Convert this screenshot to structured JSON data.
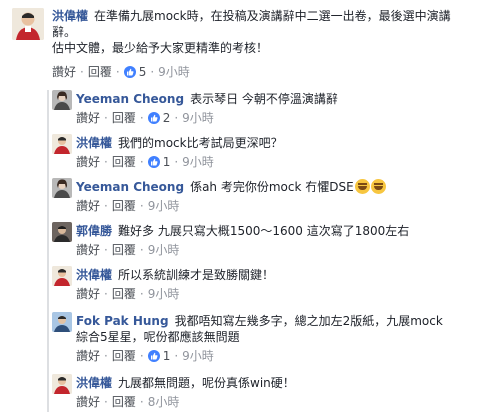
{
  "comments": [
    {
      "name": "洪偉權",
      "text_lines": [
        "在準備九展mock時，在投稿及演講辭中二選一出卷，最後選中演講",
        "辭。",
        "估中文體，最少給予大家更精準的考核！"
      ],
      "like_label": "讚好",
      "reply_label": "回覆",
      "like_count": "5",
      "time": "9小時",
      "avatar": "person-photo-red"
    },
    {
      "name": "Yeeman Cheong",
      "text_lines": [
        "表示琴日 今朝不停溫演講辭"
      ],
      "like_label": "讚好",
      "reply_label": "回覆",
      "like_count": "2",
      "time": "9小時",
      "avatar": "person-photo-gray"
    },
    {
      "name": "洪偉權",
      "text_lines": [
        "我們的mock比考試局更深吧？"
      ],
      "like_label": "讚好",
      "reply_label": "回覆",
      "like_count": "1",
      "time": "9小時",
      "avatar": "person-photo-red"
    },
    {
      "name": "Yeeman Cheong",
      "text_lines": [
        "係ah 考完你份mock 冇懼DSE"
      ],
      "like_label": "讚好",
      "reply_label": "回覆",
      "like_count": "",
      "time": "9小時",
      "avatar": "person-photo-gray",
      "emojis": [
        "laughing-emoji",
        "laughing-emoji"
      ]
    },
    {
      "name": "郭偉勝",
      "text_lines": [
        "難好多 九展只寫大概1500～1600 這次寫了1800左右"
      ],
      "like_label": "讚好",
      "reply_label": "回覆",
      "like_count": "",
      "time": "9小時",
      "avatar": "person-photo-dark"
    },
    {
      "name": "洪偉權",
      "text_lines": [
        "所以系統訓練才是致勝關鍵！"
      ],
      "like_label": "讚好",
      "reply_label": "回覆",
      "like_count": "",
      "time": "9小時",
      "avatar": "person-photo-red"
    },
    {
      "name": "Fok Pak Hung",
      "text_lines": [
        "我都唔知寫左幾多字，總之加左2版紙，九展mock",
        "綜合5星星，呢份都應該無問題"
      ],
      "like_label": "讚好",
      "reply_label": "回覆",
      "like_count": "1",
      "time": "9小時",
      "avatar": "person-photo-blue"
    },
    {
      "name": "洪偉權",
      "text_lines": [
        "九展都無問題，呢份真係win硬！"
      ],
      "like_label": "讚好",
      "reply_label": "回覆",
      "like_count": "",
      "time": "8小時",
      "avatar": "person-photo-red"
    }
  ],
  "colors": {
    "name": "#365899",
    "text": "#1d2129",
    "meta": "#90949c",
    "like_badge": "#4080ff"
  }
}
